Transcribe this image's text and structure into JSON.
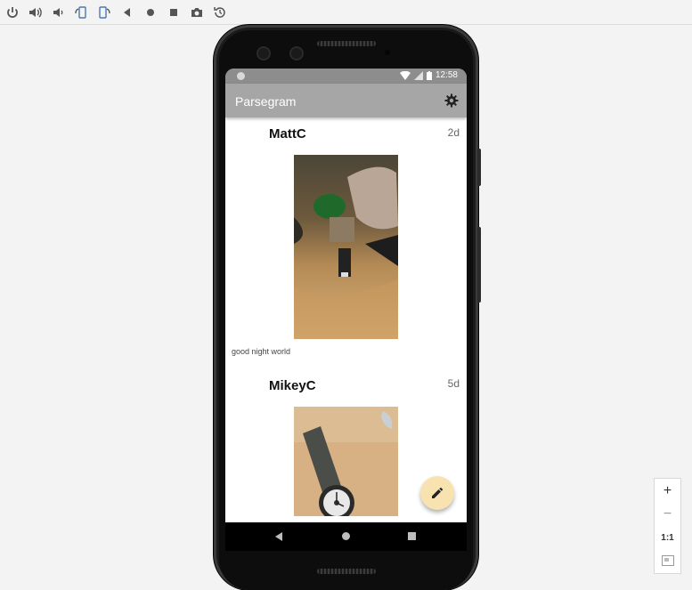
{
  "toolbar": {
    "buttons": [
      {
        "name": "power-icon"
      },
      {
        "name": "volume-up-icon"
      },
      {
        "name": "volume-down-icon"
      },
      {
        "name": "rotate-left-icon"
      },
      {
        "name": "rotate-right-icon"
      },
      {
        "name": "back-icon"
      },
      {
        "name": "home-icon"
      },
      {
        "name": "overview-icon"
      },
      {
        "name": "camera-icon"
      },
      {
        "name": "snapshot-icon"
      }
    ]
  },
  "status": {
    "time": "12:58"
  },
  "app": {
    "title": "Parsegram"
  },
  "posts": [
    {
      "username": "MattC",
      "time": "2d",
      "caption": "good night world"
    },
    {
      "username": "MikeyC",
      "time": "5d",
      "caption": ""
    }
  ],
  "zoom": {
    "plus": "+",
    "minus": "−",
    "ratio": "1:1"
  },
  "colors": {
    "appbar": "#a6a6a6",
    "statusbar": "#8d8d8d",
    "fab": "#f7e2b0"
  }
}
